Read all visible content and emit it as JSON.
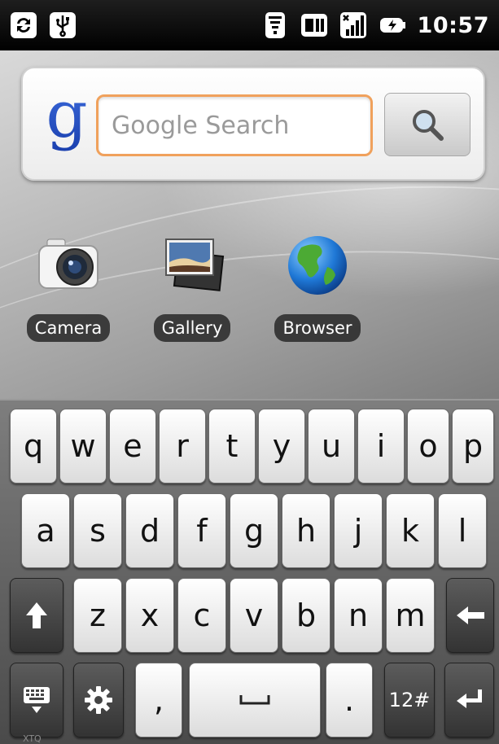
{
  "status_bar": {
    "left_icons": [
      "sync-icon",
      "usb-icon"
    ],
    "right_icons": [
      "wifi-icon",
      "sim-card-icon",
      "signal-icon",
      "battery-charging-icon"
    ],
    "time": "10:57"
  },
  "search_widget": {
    "placeholder": "Google Search",
    "logo_icon": "google-g-icon",
    "button_icon": "magnifier-icon"
  },
  "apps": [
    {
      "label": "Camera",
      "icon": "camera-icon"
    },
    {
      "label": "Gallery",
      "icon": "gallery-icon"
    },
    {
      "label": "Browser",
      "icon": "globe-icon"
    }
  ],
  "keyboard": {
    "row1": [
      "q",
      "w",
      "e",
      "r",
      "t",
      "y",
      "u",
      "i",
      "o",
      "p"
    ],
    "row2": [
      "a",
      "s",
      "d",
      "f",
      "g",
      "h",
      "j",
      "k",
      "l"
    ],
    "row3": [
      "z",
      "x",
      "c",
      "v",
      "b",
      "n",
      "m"
    ],
    "comma": ",",
    "period": ".",
    "symbols": "12#",
    "special_icons": [
      "shift-icon",
      "backspace-icon",
      "keyboard-hide-icon",
      "settings-icon",
      "space-icon",
      "enter-icon"
    ]
  },
  "watermark": "XTQ"
}
